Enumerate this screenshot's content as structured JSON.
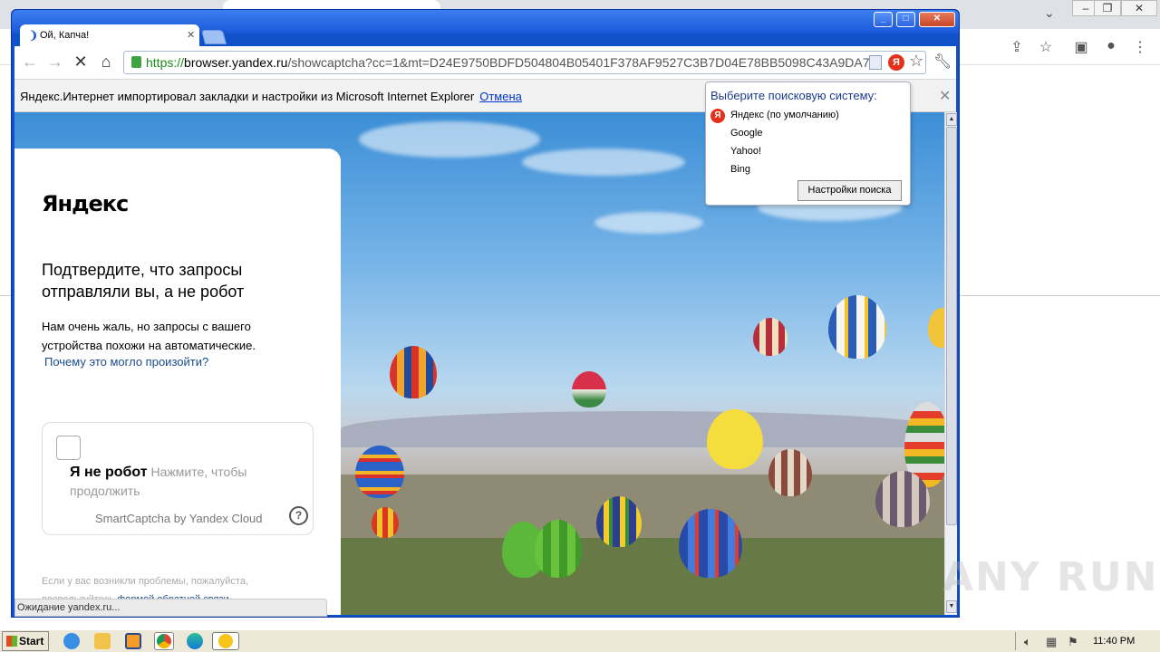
{
  "browser": {
    "tab_title": "Ой, Капча!",
    "url_scheme": "https://",
    "url_host": "browser.yandex.ru",
    "url_rest": "/showcaptcha?cc=1&mt=D24E9750BDFD504804B05401F378AF9527C3B7D04E78BB5098C43A9DA7",
    "status_text": "Ожидание yandex.ru..."
  },
  "infobar": {
    "text": "Яндекс.Интернет импортировал закладки и настройки из Microsoft Internet Explorer",
    "cancel_label": "Отмена"
  },
  "search_popup": {
    "title": "Выберите поисковую систему:",
    "engines": [
      "Яндекс (по умолчанию)",
      "Google",
      "Yahoo!",
      "Bing"
    ],
    "settings_button": "Настройки поиска"
  },
  "captcha": {
    "logo": "Яндекс",
    "title": "Подтвердите, что запросы отправляли вы, а не робот",
    "text": "Нам очень жаль, но запросы с вашего устройства похожи на автоматические.",
    "why_link": "Почему это могло произойти?",
    "checkbox_label": "Я не робот",
    "checkbox_hint": "Нажмите, чтобы продолжить",
    "brand": "SmartCaptcha by Yandex Cloud",
    "footer_text": "Если у вас возникли проблемы, пожалуйста, воспользуйтесь",
    "footer_link": "формой обратной связи"
  },
  "watermark": "ANY RUN",
  "taskbar": {
    "start_label": "Start",
    "clock": "11:40 PM"
  },
  "icons": {
    "back": "arrow-left-icon",
    "forward": "arrow-right-icon",
    "reload": "close-x-icon",
    "home": "home-icon",
    "bookmark": "star-icon",
    "menu": "wrench-icon"
  }
}
